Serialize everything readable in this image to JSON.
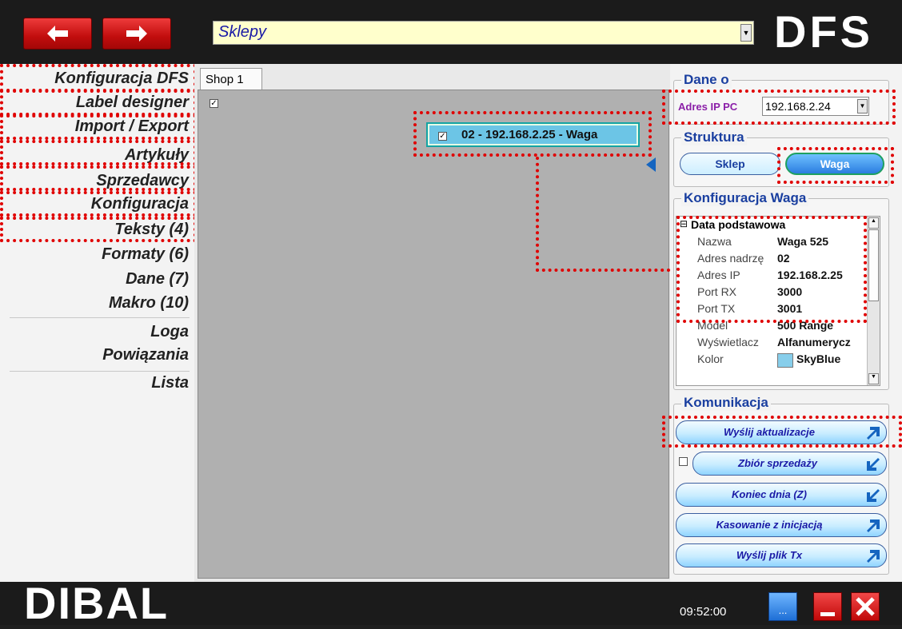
{
  "header": {
    "back_icon": "arrow-left-icon",
    "forward_icon": "arrow-right-icon",
    "combo_value": "Sklepy",
    "logo": "DFS"
  },
  "sidebar": {
    "items": [
      {
        "label": "Konfiguracja DFS"
      },
      {
        "label": "Label designer"
      },
      {
        "label": "Import / Export"
      },
      {
        "label": "Artykuły"
      },
      {
        "label": "Sprzedawcy"
      },
      {
        "label": "Konfiguracja"
      },
      {
        "label": "Teksty (4)"
      },
      {
        "label": "Formaty (6)"
      },
      {
        "label": "Dane (7)"
      },
      {
        "label": "Makro (10)"
      },
      {
        "label": "Loga"
      },
      {
        "label": "Powiązania"
      },
      {
        "label": "Lista"
      }
    ]
  },
  "main": {
    "tab": "Shop 1",
    "node_label": "02 - 192.168.2.25 - Waga"
  },
  "right": {
    "dane_title": "Dane o",
    "ip_label": "Adres IP PC",
    "ip_value": "192.168.2.24",
    "struktura_title": "Struktura",
    "sklep": "Sklep",
    "waga": "Waga",
    "konf_title": "Konfiguracja Waga",
    "grid_header": "Data podstawowa",
    "grid_rows": [
      {
        "k": "Nazwa",
        "v": "Waga 525"
      },
      {
        "k": "Adres nadrzę",
        "v": "02"
      },
      {
        "k": "Adres IP",
        "v": "192.168.2.25"
      },
      {
        "k": "Port RX",
        "v": "3000"
      },
      {
        "k": "Port TX",
        "v": "3001"
      },
      {
        "k": "Model",
        "v": "500 Range"
      },
      {
        "k": "Wyświetlacz",
        "v": "Alfanumerycz"
      },
      {
        "k": "Kolor",
        "v": "SkyBlue"
      }
    ],
    "kolor_swatch": "#87ceeb",
    "komunikacja_title": "Komunikacja",
    "buttons": [
      {
        "label": "Wyślij aktualizacje",
        "icon": "arrow-up-right-icon"
      },
      {
        "label": "Zbiór sprzedaży",
        "icon": "arrow-down-left-icon"
      },
      {
        "label": "Koniec dnia (Z)",
        "icon": "arrow-down-left-icon"
      },
      {
        "label": "Kasowanie z inicjacją",
        "icon": "arrow-up-right-icon"
      },
      {
        "label": "Wyślij plik Tx",
        "icon": "arrow-up-right-icon"
      }
    ]
  },
  "footer": {
    "logo": "DIBAL",
    "time": "09:52:00",
    "more_label": "...",
    "minimize_icon": "minimize-icon",
    "close_icon": "close-icon"
  },
  "colors": {
    "highlight_dots": "#e00000",
    "node_fill": "#6cc5e6",
    "accent_blue": "#1a3fa0"
  }
}
